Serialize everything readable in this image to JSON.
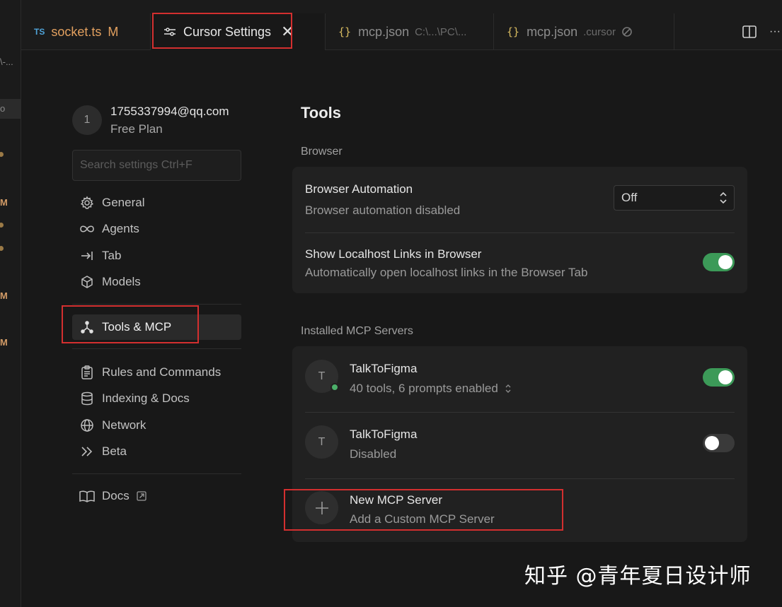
{
  "left_strip": {
    "partial_text": "\\-...",
    "sel_text": "o",
    "m_markers": [
      "M",
      "M",
      "M"
    ]
  },
  "tabs": [
    {
      "badge": "TS",
      "label": "socket.ts",
      "status": "M"
    },
    {
      "label": "Cursor Settings",
      "close": "✕"
    },
    {
      "label": "mcp.json",
      "path": "C:\\...\\PC\\..."
    },
    {
      "label": "mcp.json",
      "path": ".cursor"
    }
  ],
  "topright": {
    "more": "···"
  },
  "user": {
    "avatar_letter": "1",
    "email": "1755337994@qq.com",
    "plan": "Free Plan"
  },
  "search": {
    "placeholder": "Search settings Ctrl+F"
  },
  "nav": {
    "group1": [
      {
        "label": "General",
        "icon": "gear-icon"
      },
      {
        "label": "Agents",
        "icon": "infinity-icon"
      },
      {
        "label": "Tab",
        "icon": "tab-arrow-icon"
      },
      {
        "label": "Models",
        "icon": "cube-icon"
      }
    ],
    "active": {
      "label": "Tools & MCP",
      "icon": "tools-icon"
    },
    "group2": [
      {
        "label": "Rules and Commands",
        "icon": "clipboard-icon"
      },
      {
        "label": "Indexing & Docs",
        "icon": "database-icon"
      },
      {
        "label": "Network",
        "icon": "globe-icon"
      },
      {
        "label": "Beta",
        "icon": "double-chevron-icon"
      }
    ],
    "docs": {
      "label": "Docs",
      "icon": "book-icon"
    }
  },
  "main": {
    "title": "Tools",
    "browser_section": "Browser",
    "browser_automation": {
      "title": "Browser Automation",
      "sub": "Browser automation disabled",
      "value": "Off"
    },
    "localhost_links": {
      "title": "Show Localhost Links in Browser",
      "sub": "Automatically open localhost links in the Browser Tab",
      "enabled": true
    },
    "mcp_section": "Installed MCP Servers",
    "servers": [
      {
        "letter": "T",
        "name": "TalkToFigma",
        "sub": "40 tools, 6 prompts enabled",
        "enabled": true,
        "status": "online"
      },
      {
        "letter": "T",
        "name": "TalkToFigma",
        "sub": "Disabled",
        "enabled": false
      }
    ],
    "new_server": {
      "title": "New MCP Server",
      "sub": "Add a Custom MCP Server"
    }
  },
  "watermark": "知乎 @青年夏日设计师",
  "colors": {
    "toggle_on": "#3c9a58",
    "highlight": "#d32f2f",
    "status_online": "#4caf6a"
  }
}
